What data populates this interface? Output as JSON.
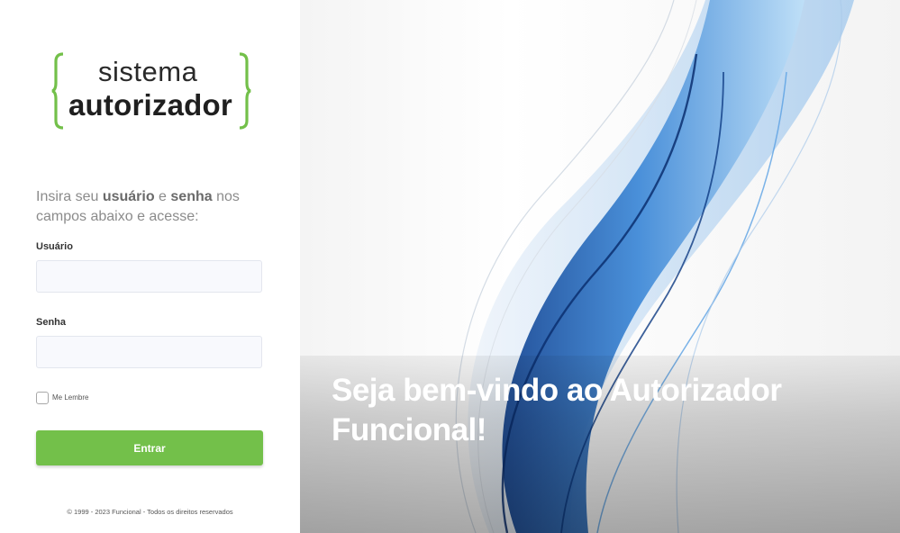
{
  "logo": {
    "top": "sistema",
    "bottom": "autorizador"
  },
  "intro": {
    "part1": "Insira seu ",
    "user_word": "usuário",
    "part2": " e ",
    "pass_word": "senha",
    "part3": " nos campos abaixo e acesse:"
  },
  "form": {
    "user_label": "Usuário",
    "user_value": "",
    "pass_label": "Senha",
    "pass_value": "",
    "remember_label": "Me Lembre",
    "remember_checked": false,
    "submit_label": "Entrar"
  },
  "footer": "© 1999 - 2023 Funcional - Todos os direitos reservados",
  "hero": {
    "welcome": "Seja bem-vindo ao Autorizador Funcional!"
  },
  "colors": {
    "accent_green": "#73c04a",
    "wave_blue": "#2f6fc0"
  }
}
